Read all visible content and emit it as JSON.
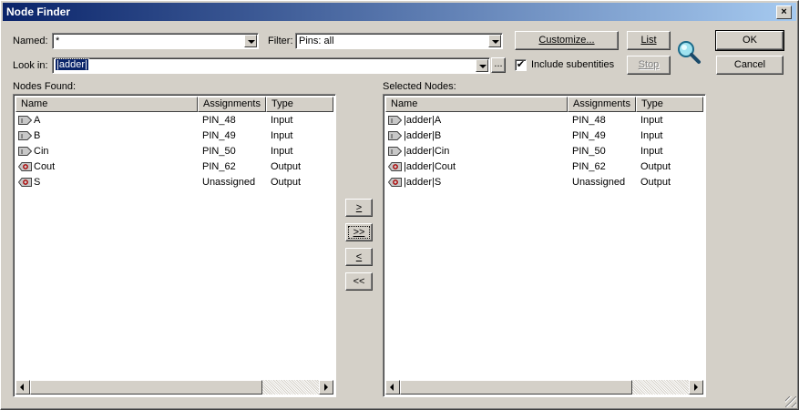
{
  "window": {
    "title": "Node Finder",
    "close_glyph": "×"
  },
  "named": {
    "label": "Named:",
    "value": "*"
  },
  "filter": {
    "label": "Filter:",
    "value": "Pins: all"
  },
  "lookin": {
    "label": "Look in:",
    "value": "|adder|",
    "browse": "..."
  },
  "buttons": {
    "customize": "Customize...",
    "list": "List",
    "stop": "Stop",
    "ok": "OK",
    "cancel": "Cancel",
    "add_one": ">",
    "add_all": ">>",
    "remove_one": "<",
    "remove_all": "<<"
  },
  "include_subentities": {
    "label": "Include subentities",
    "checked": true,
    "mark": "✔"
  },
  "found": {
    "label": "Nodes Found:",
    "columns": [
      "Name",
      "Assignments",
      "Type"
    ],
    "rows": [
      {
        "name": "A",
        "assign": "PIN_48",
        "type": "Input",
        "icon": "input-pin-icon"
      },
      {
        "name": "B",
        "assign": "PIN_49",
        "type": "Input",
        "icon": "input-pin-icon"
      },
      {
        "name": "Cin",
        "assign": "PIN_50",
        "type": "Input",
        "icon": "input-pin-icon"
      },
      {
        "name": "Cout",
        "assign": "PIN_62",
        "type": "Output",
        "icon": "output-pin-icon"
      },
      {
        "name": "S",
        "assign": "Unassigned",
        "type": "Output",
        "icon": "output-pin-icon"
      }
    ]
  },
  "selected": {
    "label": "Selected Nodes:",
    "columns": [
      "Name",
      "Assignments",
      "Type"
    ],
    "rows": [
      {
        "name": "|adder|A",
        "assign": "PIN_48",
        "type": "Input",
        "icon": "input-pin-icon"
      },
      {
        "name": "|adder|B",
        "assign": "PIN_49",
        "type": "Input",
        "icon": "input-pin-icon"
      },
      {
        "name": "|adder|Cin",
        "assign": "PIN_50",
        "type": "Input",
        "icon": "input-pin-icon"
      },
      {
        "name": "|adder|Cout",
        "assign": "PIN_62",
        "type": "Output",
        "icon": "output-pin-icon"
      },
      {
        "name": "|adder|S",
        "assign": "Unassigned",
        "type": "Output",
        "icon": "output-pin-icon"
      }
    ]
  }
}
